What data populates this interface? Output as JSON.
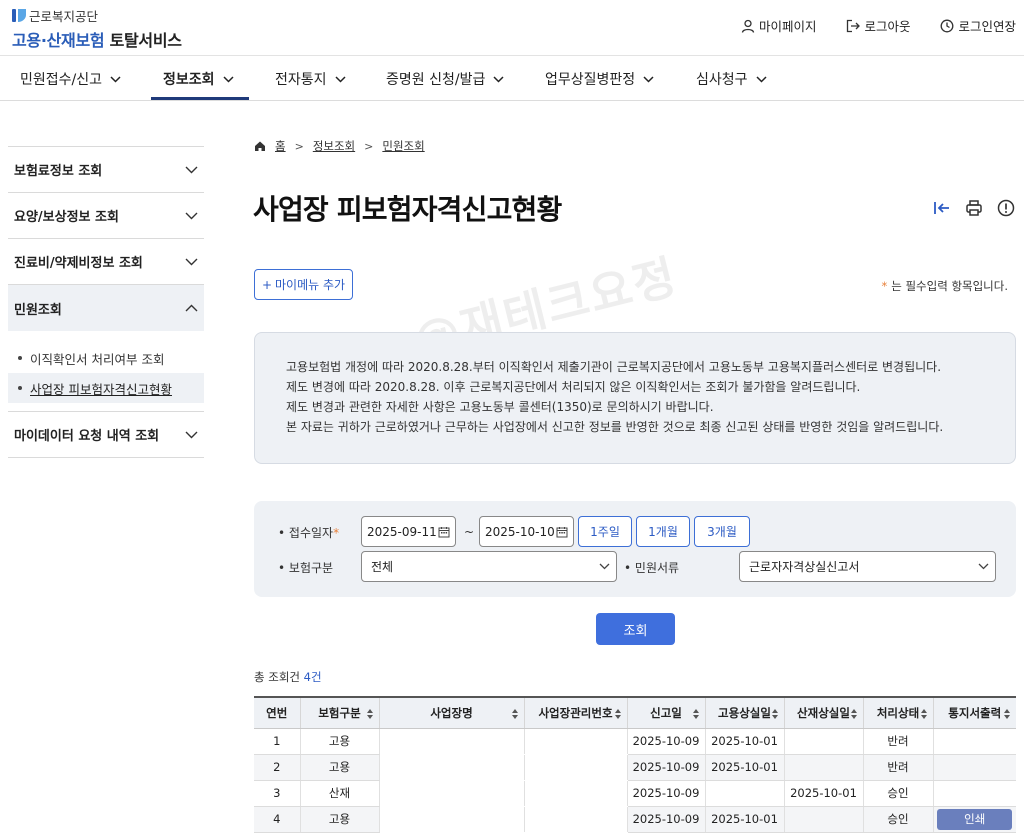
{
  "header": {
    "org_name": "근로복지공단",
    "service_blue": "고용·산재보험",
    "service_dark": "토탈서비스",
    "util": {
      "mypage": "마이페이지",
      "logout": "로그아웃",
      "extend": "로그인연장"
    }
  },
  "gnb": {
    "items": [
      {
        "label": "민원접수/신고"
      },
      {
        "label": "정보조회"
      },
      {
        "label": "전자통지"
      },
      {
        "label": "증명원 신청/발급"
      },
      {
        "label": "업무상질병판정"
      },
      {
        "label": "심사청구"
      }
    ]
  },
  "sidebar": {
    "items": [
      {
        "label": "보험료정보 조회"
      },
      {
        "label": "요양/보상정보 조회"
      },
      {
        "label": "진료비/약제비정보 조회"
      },
      {
        "label": "민원조회"
      },
      {
        "label": "마이데이터 요청 내역 조회"
      }
    ],
    "sub_items": [
      {
        "label": "이직확인서 처리여부 조회"
      },
      {
        "label": "사업장 피보험자격신고현황"
      }
    ]
  },
  "breadcrumb": {
    "home": "홈",
    "level1": "정보조회",
    "level2": "민원조회"
  },
  "page": {
    "title": "사업장 피보험자격신고현황",
    "mymenu_label": "마이메뉴 추가",
    "required_star": "*",
    "required_note": "는 필수입력 항목입니다.",
    "watermark": "@재테크요정"
  },
  "notice": {
    "lines": [
      "고용보험법 개정에 따라 2020.8.28.부터 이직확인서 제출기관이 근로복지공단에서 고용노동부 고용복지플러스센터로 변경됩니다.",
      "제도 변경에 따라 2020.8.28. 이후 근로복지공단에서 처리되지 않은 이직확인서는 조회가 불가함을 알려드립니다.",
      "제도 변경과 관련한 자세한 사항은 고용노동부 콜센터(1350)로 문의하시기 바랍니다.",
      "본 자료는 귀하가 근로하였거나 근무하는 사업장에서 신고한 정보를 반영한 것으로 최종 신고된 상태를 반영한 것임을 알려드립니다."
    ]
  },
  "search": {
    "date_label": "접수일자",
    "date_from": "2025-09-11",
    "date_to": "2025-10-10",
    "tilde": "~",
    "range_buttons": [
      {
        "label": "1주일"
      },
      {
        "label": "1개월"
      },
      {
        "label": "3개월"
      }
    ],
    "insurance_label": "보험구분",
    "insurance_value": "전체",
    "doc_label": "민원서류",
    "doc_value": "근로자자격상실신고서",
    "submit_label": "조회"
  },
  "results": {
    "total_prefix": "총 조회건",
    "total_count": "4건",
    "columns": [
      "연번",
      "보험구분",
      "사업장명",
      "사업장관리번호",
      "신고일",
      "고용상실일",
      "산재상실일",
      "처리상태",
      "통지서출력"
    ],
    "rows": [
      {
        "no": "1",
        "type": "고용",
        "name": "",
        "mgmt": "",
        "report": "2025-10-09",
        "emp_loss": "2025-10-01",
        "ind_loss": "",
        "status": "반려",
        "print": ""
      },
      {
        "no": "2",
        "type": "고용",
        "name": "",
        "mgmt": "",
        "report": "2025-10-09",
        "emp_loss": "2025-10-01",
        "ind_loss": "",
        "status": "반려",
        "print": ""
      },
      {
        "no": "3",
        "type": "산재",
        "name": "",
        "mgmt": "",
        "report": "2025-10-09",
        "emp_loss": "",
        "ind_loss": "2025-10-01",
        "status": "승인",
        "print": ""
      },
      {
        "no": "4",
        "type": "고용",
        "name": "",
        "mgmt": "",
        "report": "2025-10-09",
        "emp_loss": "2025-10-01",
        "ind_loss": "",
        "status": "승인",
        "print": "인쇄"
      }
    ]
  },
  "colors": {
    "brand_blue": "#2a5db8",
    "accent_button": "#3f6fdd",
    "gnb_underline": "#1f3a7a",
    "required_star": "#e8813a",
    "panel_bg": "#eef1f5",
    "print_button": "#6a7fbd"
  }
}
